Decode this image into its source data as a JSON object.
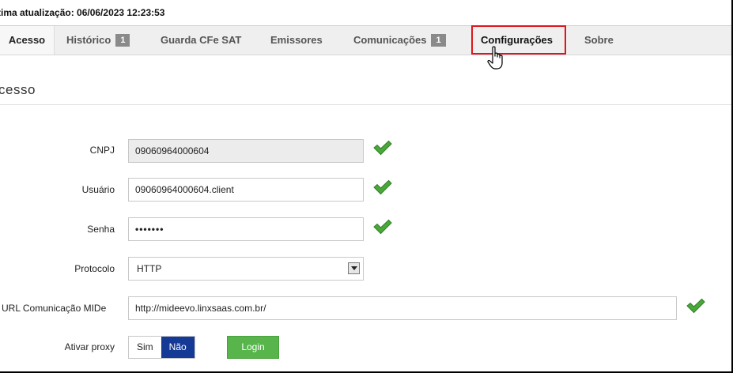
{
  "status_bar": {
    "last_update": "tima atualização: 06/06/2023 12:23:53"
  },
  "tabs": [
    {
      "label": "Acesso",
      "badge": null
    },
    {
      "label": "Histórico",
      "badge": "1"
    },
    {
      "label": "Guarda CFe SAT",
      "badge": null
    },
    {
      "label": "Emissores",
      "badge": null
    },
    {
      "label": "Comunicações",
      "badge": "1"
    },
    {
      "label": "Configurações",
      "badge": null
    },
    {
      "label": "Sobre",
      "badge": null
    }
  ],
  "section": {
    "title": "cesso"
  },
  "form": {
    "cnpj": {
      "label": "CNPJ",
      "value": "09060964000604"
    },
    "usuario": {
      "label": "Usuário",
      "value": "09060964000604.client"
    },
    "senha": {
      "label": "Senha",
      "value": "•••••••"
    },
    "protocolo": {
      "label": "Protocolo",
      "value": "HTTP"
    },
    "url": {
      "label": "URL Comunicação MIDe",
      "value": "http://mideevo.linxsaas.com.br/"
    },
    "proxy": {
      "label": "Ativar proxy",
      "yes": "Sim",
      "no": "Não"
    },
    "login_label": "Login"
  },
  "colors": {
    "highlight": "#e0141b",
    "check": "#4aa83a",
    "toggle_on": "#153a95",
    "login": "#58b54c"
  }
}
